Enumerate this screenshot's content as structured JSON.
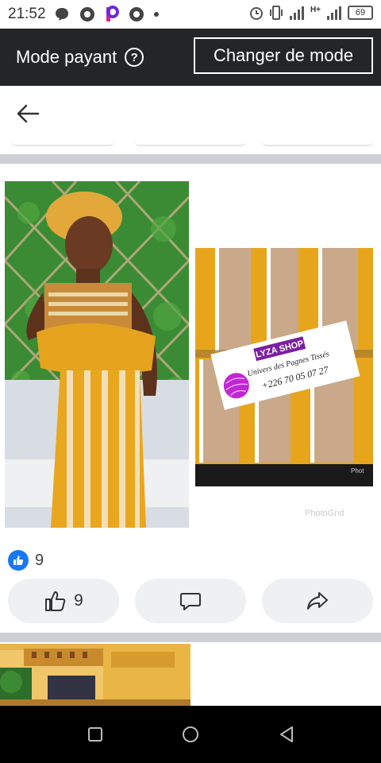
{
  "status_bar": {
    "time": "21:52",
    "network": "H+",
    "battery": "69",
    "icons": [
      "chat-bubble-icon",
      "record-icon",
      "picsart-icon",
      "record-icon",
      "dot-icon"
    ]
  },
  "mode_bar": {
    "label": "Mode payant",
    "help_icon": "?",
    "change_button": "Changer de mode"
  },
  "header": {
    "back_icon": "arrow-left-icon"
  },
  "post": {
    "image2_brand": "LYZA SHOP",
    "image2_tagline": "Univers des Pagnes Tissés",
    "image2_phone": "+226 70 05 07 27",
    "image2_watermark": "Phot",
    "watermark": "PhotoGrid",
    "reaction_count": "9",
    "like_count": "9"
  },
  "colors": {
    "mode_bar_bg": "#242526",
    "like_blue": "#1877f2",
    "pill_bg": "#eff0f2",
    "separator": "#ccd0d5",
    "fabric_orange": "#e7a51c"
  }
}
